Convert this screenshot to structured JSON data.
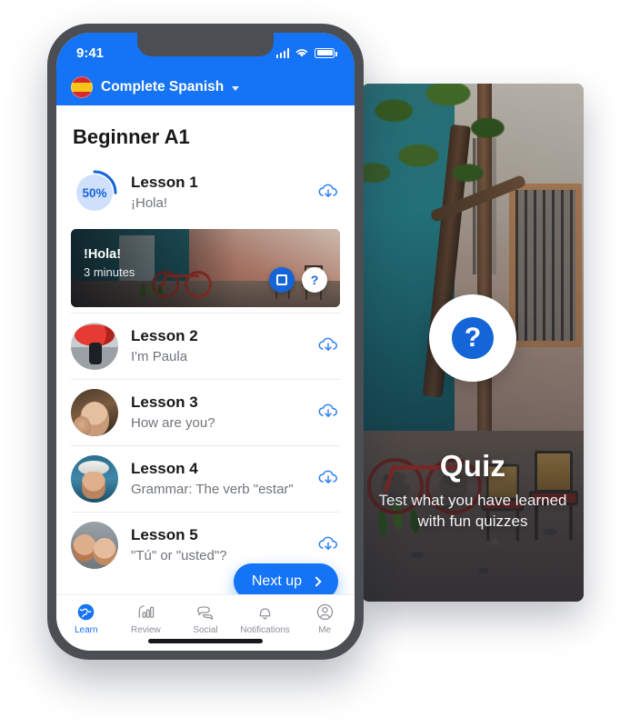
{
  "quiz_panel": {
    "title": "Quiz",
    "subtitle_line1": "Test what you have learned",
    "subtitle_line2": "with fun quizzes",
    "badge_icon": "question-mark-icon",
    "badge_symbol": "?"
  },
  "phone": {
    "status_bar": {
      "time": "9:41",
      "icons": [
        "signal-icon",
        "wifi-icon",
        "battery-icon"
      ]
    },
    "app_bar": {
      "flag_icon": "spain-flag-icon",
      "title": "Complete Spanish",
      "chevron": "chevron-down-icon"
    },
    "page_title": "Beginner A1",
    "lessons": [
      {
        "name": "Lesson 1",
        "subtitle": "¡Hola!",
        "progress_percent": "50%",
        "progress_value": 50,
        "download_icon": "cloud-download-icon"
      },
      {
        "name": "Lesson 2",
        "subtitle": "I'm Paula",
        "download_icon": "cloud-download-icon"
      },
      {
        "name": "Lesson 3",
        "subtitle": "How are you?",
        "download_icon": "cloud-download-icon"
      },
      {
        "name": "Lesson 4",
        "subtitle": "Grammar: The verb \"estar\"",
        "download_icon": "cloud-download-icon"
      },
      {
        "name": "Lesson 5",
        "subtitle": "\"Tú\" or \"usted\"?",
        "download_icon": "cloud-download-icon"
      }
    ],
    "media_card": {
      "title": "!Hola!",
      "duration": "3 minutes",
      "primary_action_icon": "lesson-card-icon",
      "secondary_action_icon": "question-mark-icon",
      "secondary_action_symbol": "?"
    },
    "next_up_button": {
      "label": "Next up",
      "chevron": "chevron-right-icon"
    },
    "tabs": [
      {
        "label": "Learn",
        "icon": "globe-icon",
        "active": true
      },
      {
        "label": "Review",
        "icon": "bar-chart-icon",
        "active": false
      },
      {
        "label": "Social",
        "icon": "chat-bubbles-icon",
        "active": false
      },
      {
        "label": "Notifications",
        "icon": "bell-icon",
        "active": false
      },
      {
        "label": "Me",
        "icon": "person-icon",
        "active": false
      }
    ]
  },
  "colors": {
    "accent_blue": "#1573F5",
    "badge_blue": "#1565D8",
    "bezel_gray": "#4b4e53",
    "muted_text": "#6f757c"
  }
}
